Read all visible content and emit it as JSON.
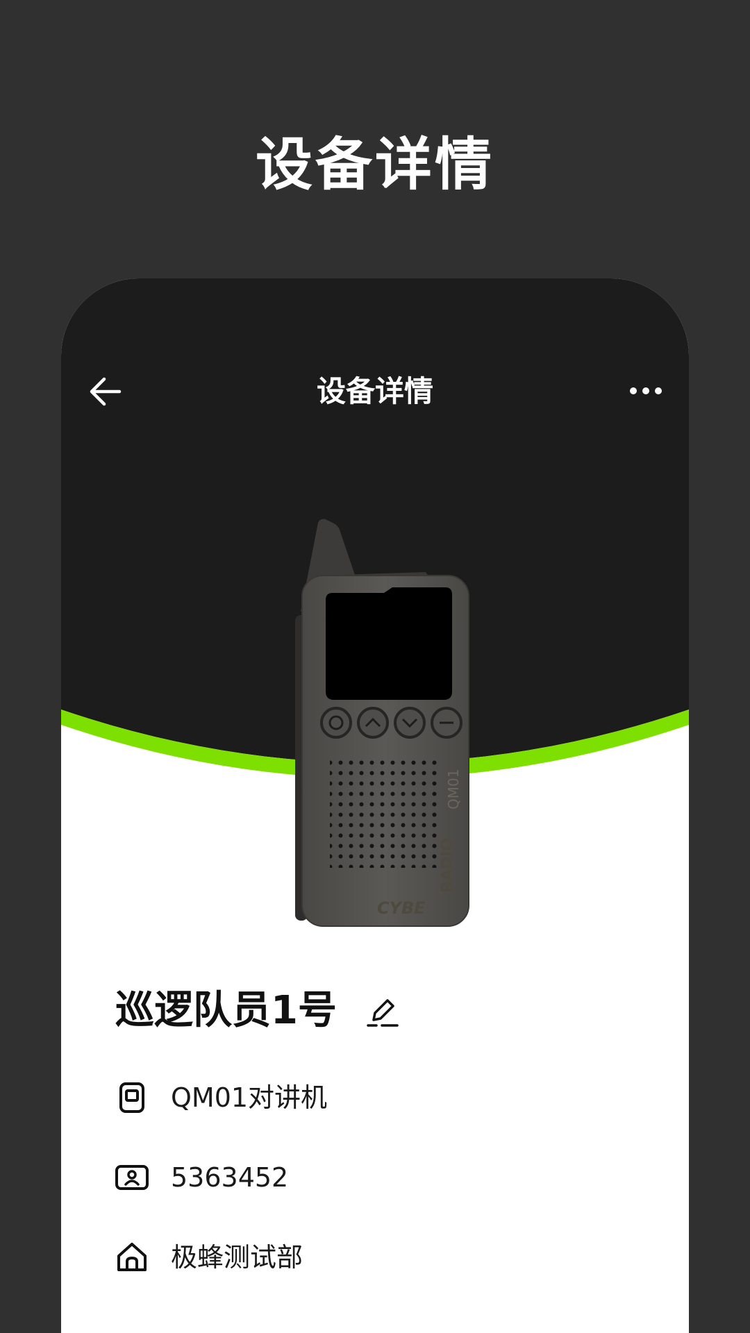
{
  "page": {
    "title": "设备详情"
  },
  "nav": {
    "title": "设备详情",
    "back_icon": "arrow-left-icon",
    "more_icon": "more-horizontal-icon"
  },
  "device": {
    "name": "巡逻队员1号",
    "model": "QM01对讲机",
    "id": "5363452",
    "department": "极蜂测试部",
    "brand_text": "CYBERADIO",
    "model_text": "QM01"
  },
  "colors": {
    "accent": "#7EE000",
    "dark": "#1C1C1C",
    "outer": "#303030"
  }
}
